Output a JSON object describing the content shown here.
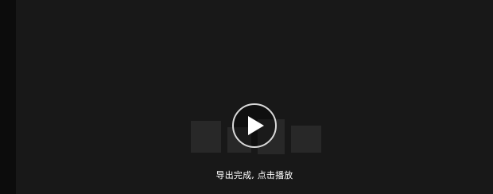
{
  "player": {
    "status_text": "导出完成, 点击播放",
    "play_icon": "play-icon",
    "background_color": "#181818",
    "accent_color": "#ffffff"
  }
}
